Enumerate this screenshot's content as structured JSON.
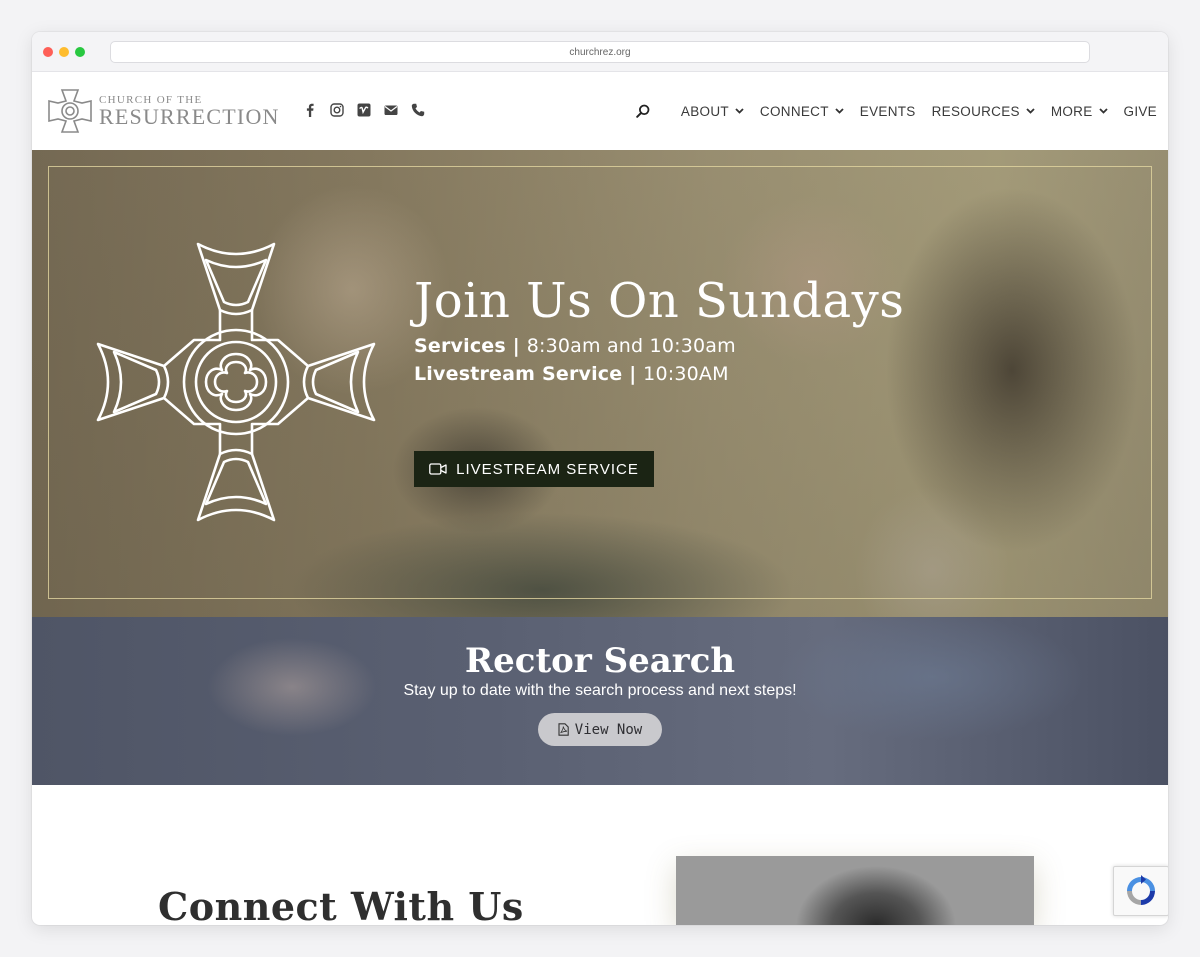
{
  "browser": {
    "url": "churchrez.org"
  },
  "header": {
    "logo_line1": "CHURCH OF THE",
    "logo_line2": "RESURRECTION",
    "social_icons": [
      "facebook-icon",
      "instagram-icon",
      "vimeo-icon",
      "email-icon",
      "phone-icon"
    ],
    "nav": [
      {
        "label": "ABOUT",
        "has_dropdown": true
      },
      {
        "label": "CONNECT",
        "has_dropdown": true
      },
      {
        "label": "EVENTS",
        "has_dropdown": false
      },
      {
        "label": "RESOURCES",
        "has_dropdown": true
      },
      {
        "label": "MORE",
        "has_dropdown": true
      },
      {
        "label": "GIVE",
        "has_dropdown": false
      }
    ]
  },
  "hero": {
    "title": "Join Us On Sundays",
    "services_label": "Services",
    "services_sep": " | ",
    "services_times": "8:30am and 10:30am",
    "livestream_label": "Livestream Service",
    "livestream_sep": " | ",
    "livestream_time": "10:30AM",
    "button_label": "LIVESTREAM SERVICE",
    "button_icon": "video-camera-icon"
  },
  "rector": {
    "title": "Rector Search",
    "subtitle": "Stay up to date with the search process and next steps!",
    "button_label": "View Now",
    "button_icon": "pdf-file-icon"
  },
  "connect": {
    "title": "Connect With Us"
  },
  "colors": {
    "frame": "#e2d6a0",
    "livestream_button": "#1b2414",
    "nav_text": "#3a3a3a",
    "rector_bg": "#5a6072"
  }
}
